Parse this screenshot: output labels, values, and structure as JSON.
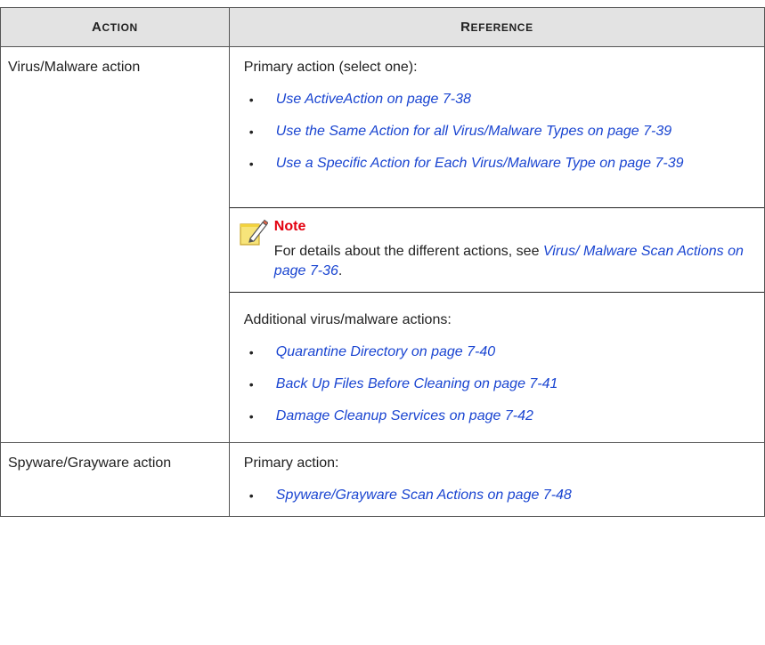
{
  "header": {
    "action": {
      "first": "A",
      "rest": "CTION"
    },
    "reference": {
      "first": "R",
      "rest": "EFERENCE"
    }
  },
  "rows": [
    {
      "action": "Virus/Malware action",
      "primary_intro": "Primary action (select one):",
      "primary_links": [
        "Use ActiveAction on page 7-38",
        "Use the Same Action for all Virus/Malware Types on page 7-39",
        "Use a Specific Action for Each Virus/Malware Type on page 7-39"
      ],
      "note": {
        "title": "Note",
        "text_before": "For details about the different actions, see ",
        "link": "Virus/ Malware Scan Actions on page 7-36",
        "text_after": "."
      },
      "additional_intro": "Additional virus/malware actions:",
      "additional_links": [
        "Quarantine Directory on page 7-40",
        "Back Up Files Before Cleaning on page 7-41",
        "Damage Cleanup Services on page 7-42"
      ]
    },
    {
      "action": "Spyware/Grayware action",
      "primary_intro": "Primary action:",
      "primary_links": [
        "Spyware/Grayware Scan Actions on page 7-48"
      ]
    }
  ],
  "icons": {
    "bullet": "•",
    "note_icon": "note-pencil-icon"
  },
  "colors": {
    "link": "#1a45d1",
    "note_title": "#e3000f",
    "header_bg": "#e3e3e3"
  }
}
